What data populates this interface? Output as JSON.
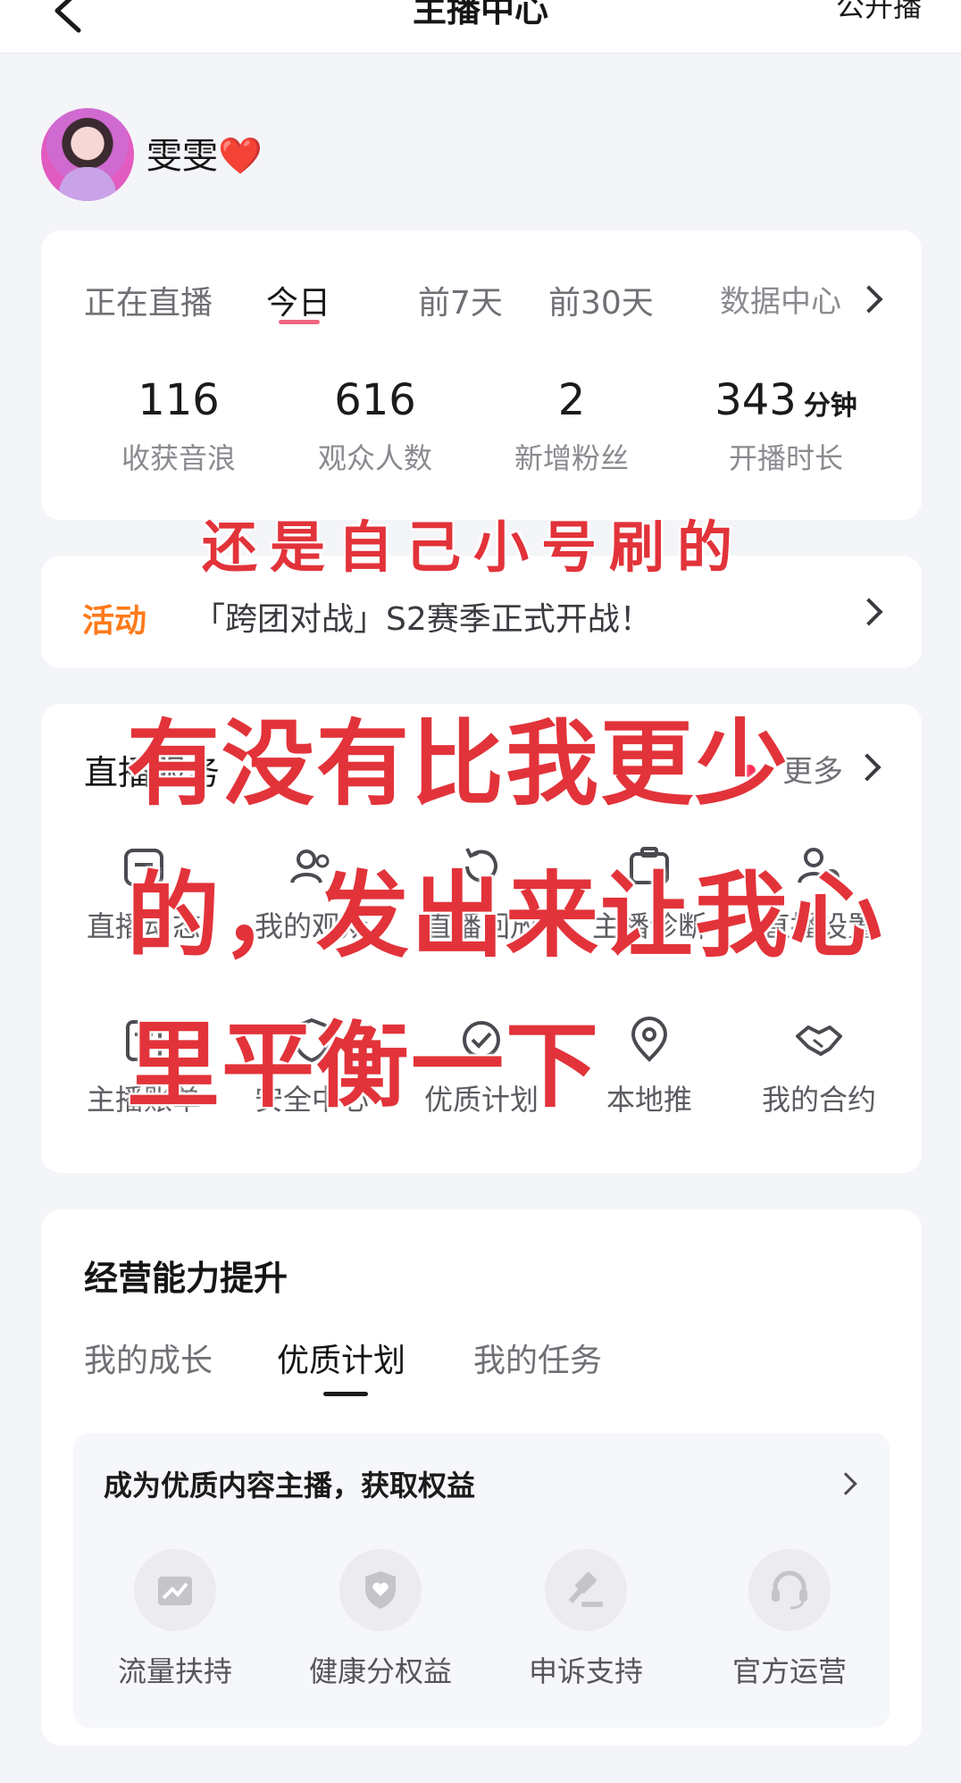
{
  "header": {
    "title": "主播中心",
    "right_action": "公开播"
  },
  "profile": {
    "name": "雯雯",
    "name_emoji": "❤️"
  },
  "stats": {
    "tabs": [
      "正在直播",
      "今日",
      "前7天",
      "前30天"
    ],
    "active_tab": "今日",
    "data_center_label": "数据中心",
    "items": [
      {
        "value": "116",
        "unit": "",
        "label": "收获音浪"
      },
      {
        "value": "616",
        "unit": "",
        "label": "观众人数"
      },
      {
        "value": "2",
        "unit": "",
        "label": "新增粉丝"
      },
      {
        "value": "343",
        "unit": "分钟",
        "label": "开播时长"
      }
    ]
  },
  "activity": {
    "tag": "活动",
    "text": "「跨团对战」S2赛季正式开战！"
  },
  "services": {
    "title": "直播服务",
    "more_label": "更多",
    "items": [
      {
        "label": "直播动态",
        "icon": "live-moments-icon"
      },
      {
        "label": "我的观众",
        "icon": "audience-icon"
      },
      {
        "label": "直播回放",
        "icon": "replay-icon"
      },
      {
        "label": "主播诊断",
        "icon": "diagnosis-icon"
      },
      {
        "label": "直播设置",
        "icon": "settings-icon"
      },
      {
        "label": "主播账单",
        "icon": "bill-icon"
      },
      {
        "label": "安全中心",
        "icon": "security-icon"
      },
      {
        "label": "优质计划",
        "icon": "quality-plan-icon"
      },
      {
        "label": "本地推",
        "icon": "location-pin-icon"
      },
      {
        "label": "我的合约",
        "icon": "handshake-icon"
      }
    ]
  },
  "business": {
    "title": "经营能力提升",
    "tabs": [
      "我的成长",
      "优质计划",
      "我的任务"
    ],
    "active_tab": "优质计划",
    "plan_title": "成为优质内容主播，获取权益",
    "benefits": [
      {
        "label": "流量扶持",
        "icon": "traffic-icon"
      },
      {
        "label": "健康分权益",
        "icon": "shield-heart-icon"
      },
      {
        "label": "申诉支持",
        "icon": "gavel-icon"
      },
      {
        "label": "官方运营",
        "icon": "headset-icon"
      }
    ]
  },
  "overlay_captions": {
    "line_small": "还是自己小号刷的",
    "line_1": "有没有比我更少",
    "line_2": "的，发出来让我心",
    "line_3": "里平衡一下"
  },
  "colors": {
    "accent_underline": "#f0657f",
    "activity_tag": "#ff7a1a",
    "caption_red": "#e2333a",
    "badge_dot": "#ff2a55"
  }
}
